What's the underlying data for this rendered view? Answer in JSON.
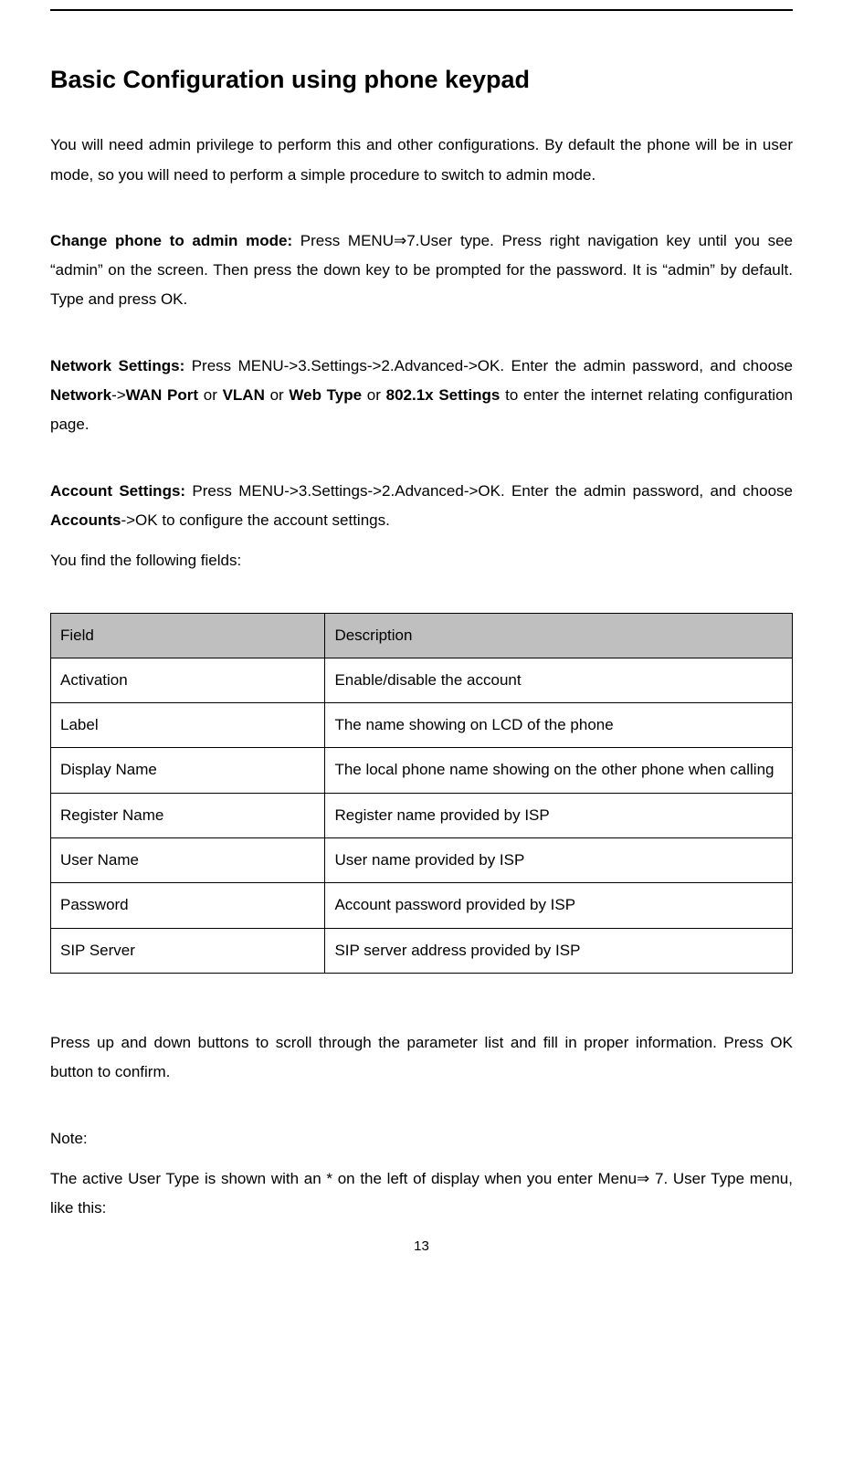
{
  "heading": "Basic Configuration using phone keypad",
  "intro": "You will need admin privilege to perform this and other configurations. By default the phone will be in user mode, so you will need to perform a simple procedure to switch to admin mode.",
  "change_admin": {
    "label": "Change phone to admin mode: ",
    "text": "Press MENU⇒7.User type. Press right navigation key until you see “admin” on the screen. Then press the down key to be prompted for the password. It is “admin” by default. Type and press OK."
  },
  "network_settings": {
    "label": "Network Settings: ",
    "text_1": "Press MENU->3.Settings->2.Advanced->OK. Enter the admin password, and choose ",
    "bold_1": "Network",
    "text_2": "->",
    "bold_2": "WAN Port",
    "text_3": " or ",
    "bold_3": "VLAN",
    "text_4": " or ",
    "bold_4": "Web Type",
    "text_5": " or ",
    "bold_5": "802.1x Settings",
    "text_6": " to enter the internet relating configuration page."
  },
  "account_settings": {
    "label": "Account Settings: ",
    "text_1": "Press MENU->3.Settings->2.Advanced->OK. Enter the admin password, and choose ",
    "bold_1": "Accounts",
    "text_2": "->OK to configure the account settings."
  },
  "fields_line": "You find the following fields:",
  "table": {
    "header": {
      "field": "Field",
      "desc": "Description"
    },
    "rows": [
      {
        "field": "Activation",
        "desc": "Enable/disable the account"
      },
      {
        "field": "Label",
        "desc": "The name showing on LCD of the phone"
      },
      {
        "field": "Display Name",
        "desc": "The local phone name showing on the other phone when calling"
      },
      {
        "field": "Register Name",
        "desc": "Register name provided by ISP"
      },
      {
        "field": "User Name",
        "desc": "User name provided by ISP"
      },
      {
        "field": "Password",
        "desc": "Account password provided by ISP"
      },
      {
        "field": "SIP Server",
        "desc": "SIP server address provided by ISP"
      }
    ]
  },
  "press_para": "Press up and down buttons to scroll through the parameter list and fill in proper information. Press OK button to confirm.",
  "note_label": "Note:",
  "note_text": "The active User Type is shown with an * on the left of display when you enter Menu⇒ 7. User Type menu, like this:",
  "page_number": "13"
}
